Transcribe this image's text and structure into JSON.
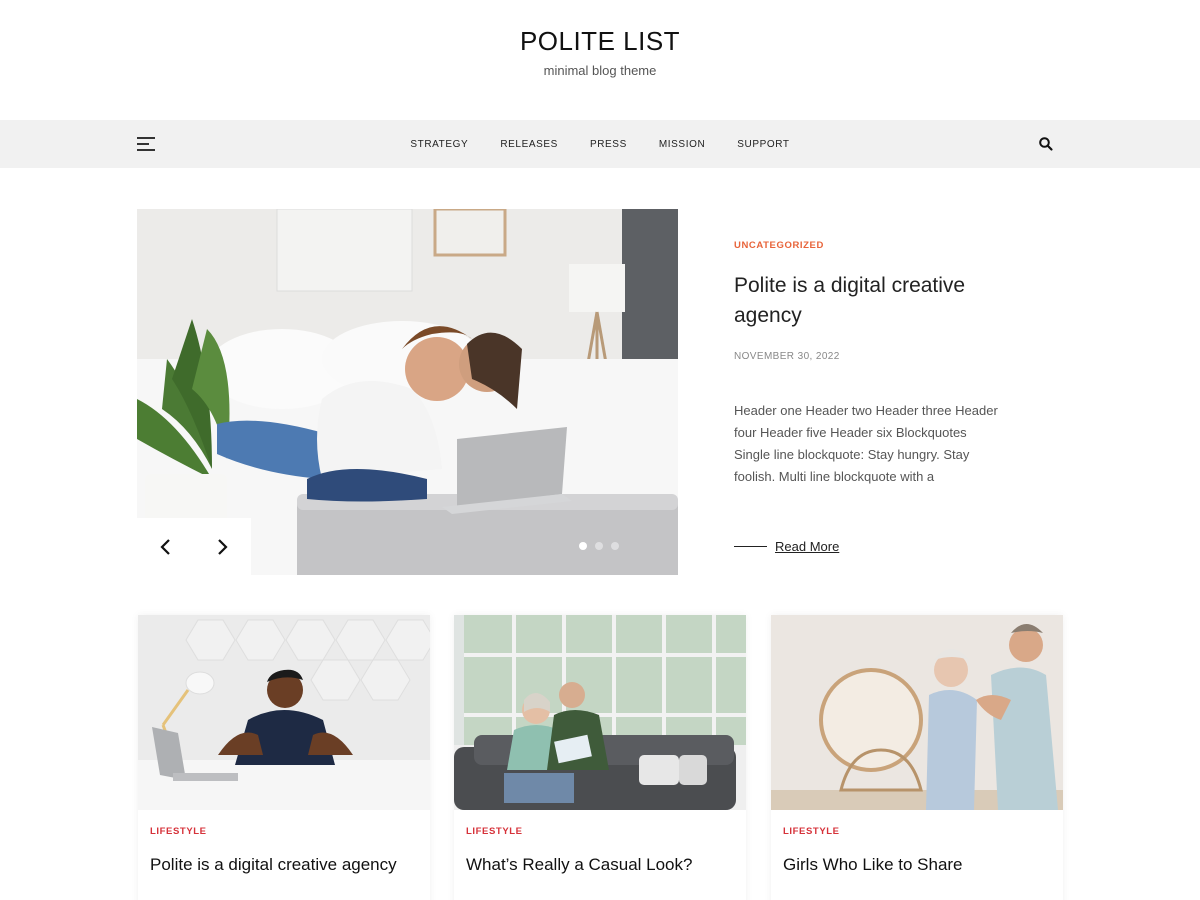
{
  "site": {
    "title": "POLITE LIST",
    "tagline": "minimal blog theme"
  },
  "nav": {
    "menu_icon": "hamburger-menu-icon",
    "items": [
      {
        "label": "STRATEGY"
      },
      {
        "label": "RELEASES"
      },
      {
        "label": "PRESS"
      },
      {
        "label": "MISSION"
      },
      {
        "label": "SUPPORT"
      }
    ],
    "search_icon": "search-icon"
  },
  "featured": {
    "category": "UNCATEGORIZED",
    "title": "Polite is a digital creative agency",
    "date": "NOVEMBER 30, 2022",
    "excerpt": "Header one Header two Header three Header four Header five Header six Blockquotes Single line blockquote: Stay hungry. Stay foolish. Multi line blockquote with a",
    "read_more": "Read More",
    "slider": {
      "prev_icon": "chevron-left-icon",
      "next_icon": "chevron-right-icon",
      "slide_count": 3,
      "active_slide": 1
    }
  },
  "posts": [
    {
      "category": "LIFESTYLE",
      "title": "Polite is a digital creative agency"
    },
    {
      "category": "LIFESTYLE",
      "title": "What’s Really a Casual Look?"
    },
    {
      "category": "LIFESTYLE",
      "title": "Girls Who Like to Share"
    }
  ],
  "colors": {
    "featured_category": "#e8643a",
    "card_category": "#d6323a",
    "nav_background": "#f1f1f1"
  }
}
